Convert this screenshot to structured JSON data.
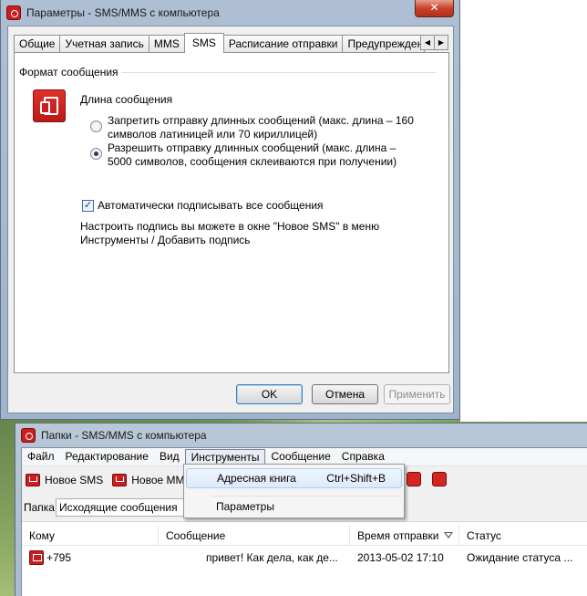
{
  "params_window": {
    "title": "Параметры - SMS/MMS с компьютера",
    "close": "✕",
    "tabs": [
      "Общие",
      "Учетная запись",
      "MMS",
      "SMS",
      "Расписание отправки",
      "Предупреждения"
    ],
    "active_tab": "SMS",
    "tab_scroll_left": "◀",
    "tab_scroll_right": "▶",
    "group_title": "Формат сообщения",
    "length_label": "Длина сообщения",
    "radio_options": [
      {
        "text": "Запретить отправку длинных сообщений (макс. длина – 160 символов латиницей или 70 кириллицей)",
        "selected": false
      },
      {
        "text": "Разрешить отправку длинных сообщений (макс. длина – 5000 символов, сообщения склеиваются при получении)",
        "selected": true
      }
    ],
    "auto_sign": {
      "label": "Автоматически подписывать все сообщения",
      "checked": true,
      "mark": "✓"
    },
    "hint": "Настроить подпись вы можете в окне \"Новое SMS\" в меню Инструменты / Добавить подпись",
    "buttons": {
      "ok": "OK",
      "cancel": "Отмена",
      "apply": "Применить"
    }
  },
  "folders_window": {
    "title": "Папки - SMS/MMS с компьютера",
    "menu": [
      "Файл",
      "Редактирование",
      "Вид",
      "Инструменты",
      "Сообщение",
      "Справка"
    ],
    "open_menu": "Инструменты",
    "toolbar": {
      "new_sms": "Новое SMS",
      "new_mms": "Новое MMS"
    },
    "folder_label": "Папка",
    "folder_value": "Исходящие сообщения",
    "columns": [
      "Кому",
      "Сообщение",
      "Время отправки",
      "Статус"
    ],
    "rows": [
      {
        "to": "+795",
        "message": "привет! Как дела, как де...",
        "time": "2013-05-02 17:10",
        "status": "Ожидание статуса ..."
      }
    ]
  },
  "tools_menu": {
    "items": [
      {
        "label": "Адресная книга",
        "shortcut": "Ctrl+Shift+B"
      },
      {
        "label": "Параметры",
        "shortcut": ""
      }
    ]
  },
  "colors": {
    "brand_red": "#c8201e",
    "window_frame": "#aebfd3"
  }
}
